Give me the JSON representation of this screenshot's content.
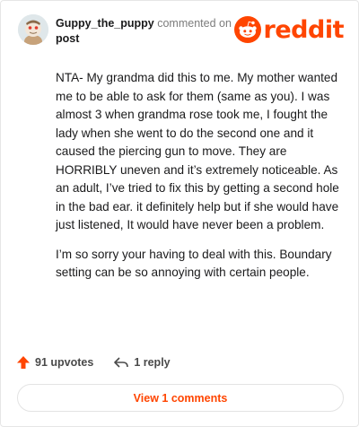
{
  "header": {
    "username": "Guppy_the_puppy",
    "action_text": "commented on",
    "post_link": "post",
    "logo_text": "reddit"
  },
  "comment": {
    "paragraphs": [
      "NTA- My grandma did this to me. My mother wanted me to be able to ask for them (same as you). I was almost 3 when grandma rose took me, I fought the lady when she went to do the second one and it caused the piercing gun to move. They are HORRIBLY uneven and it’s extremely noticeable. As an adult, I’ve tried to fix this by getting a second hole in the bad ear. it definitely help but if she would have just listened, It would have never been a problem.",
      "I’m so sorry your having to deal with this. Boundary setting can be so annoying with certain people."
    ]
  },
  "footer": {
    "upvotes": "91 upvotes",
    "replies": "1 reply",
    "view_comments": "View 1 comments"
  },
  "colors": {
    "brand": "#ff4500",
    "text": "#1a1a1b",
    "muted": "#7c7c7c"
  },
  "icons": {
    "avatar": "snoo-avatar",
    "logo": "reddit-snoo-icon",
    "upvote": "upvote-arrow-icon",
    "reply": "reply-arrow-icon"
  }
}
